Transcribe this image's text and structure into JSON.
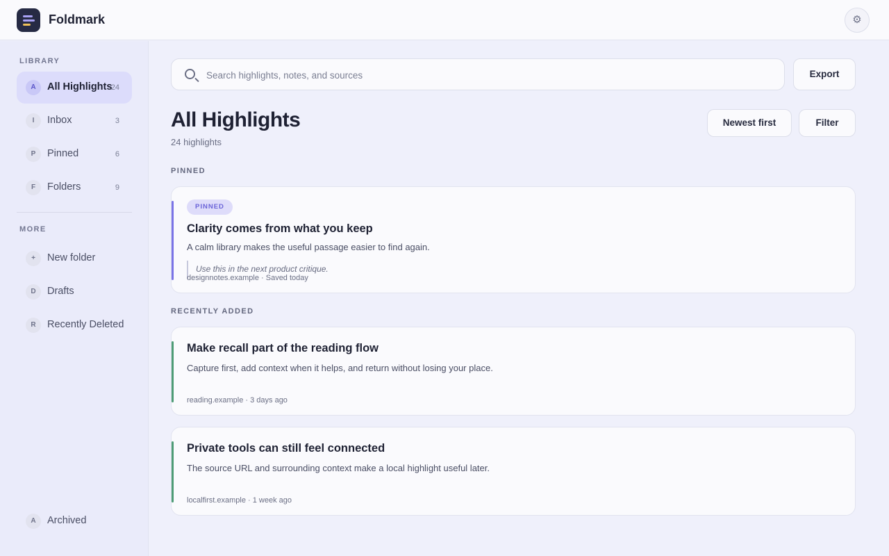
{
  "app": {
    "name": "Foldmark",
    "settings_icon": "gear-icon",
    "settings_glyph": "⚙"
  },
  "sidebar": {
    "library_label": "LIBRARY",
    "library_items": [
      {
        "badge": "A",
        "label": "All Highlights",
        "count": "24",
        "active": true
      },
      {
        "badge": "I",
        "label": "Inbox",
        "count": "3"
      },
      {
        "badge": "P",
        "label": "Pinned",
        "count": "6"
      },
      {
        "badge": "F",
        "label": "Folders",
        "count": "9"
      }
    ],
    "more_label": "MORE",
    "more_items": [
      {
        "badge": "+",
        "label": "New folder"
      },
      {
        "badge": "D",
        "label": "Drafts"
      },
      {
        "badge": "R",
        "label": "Recently Deleted"
      }
    ],
    "footer_item": {
      "badge": "A",
      "label": "Archived"
    }
  },
  "toolbar": {
    "search_placeholder": "Search highlights, notes, and sources",
    "search_value": "",
    "export_label": "Export"
  },
  "header": {
    "title": "All Highlights",
    "subtitle": "24 highlights",
    "sort_label": "Newest first",
    "filter_label": "Filter"
  },
  "pinned_section": {
    "label": "PINNED",
    "cards": [
      {
        "badge": "PINNED",
        "title": "Clarity comes from what you keep",
        "text": "A calm library makes the useful passage easier to find again.",
        "note": "Use this in the next product critique.",
        "meta": "designnotes.example · Saved today",
        "accent": "#7b74e6"
      }
    ]
  },
  "recent_section": {
    "label": "RECENTLY ADDED",
    "cards": [
      {
        "title": "Make recall part of the reading flow",
        "text": "Capture first, add context when it helps, and return without losing your place.",
        "meta": "reading.example · 3 days ago",
        "accent": "#4e9c76"
      },
      {
        "title": "Private tools can still feel connected",
        "text": "The source URL and surrounding context make a local highlight useful later.",
        "meta": "localfirst.example · 1 week ago",
        "accent": "#4e9c76"
      }
    ]
  }
}
